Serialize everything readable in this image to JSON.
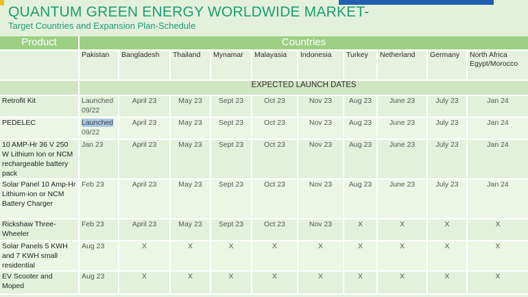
{
  "header": {
    "title": "QUANTUM GREEN ENERGY WORLDWIDE MARKET-",
    "subtitle": "Target Countries and Expansion Plan-Schedule"
  },
  "table": {
    "product_header": "Product",
    "countries_header": "Countries",
    "countries": [
      "Pakistan",
      "Bangladesh",
      "Thailand",
      "Mynamar",
      "Malayasia",
      "Indonesia",
      "Turkey",
      "Netherland",
      "Germany",
      "North Africa Egypt/Morocco"
    ],
    "band_label": "EXPECTED LAUNCH DATES",
    "rows": [
      {
        "product": "Retrofit Kit",
        "cells": [
          "Launched 09/22",
          "April 23",
          "May 23",
          "Sept 23",
          "Oct 23",
          "Nov 23",
          "Aug 23",
          "June 23",
          "July 23",
          "Jan 24"
        ]
      },
      {
        "product": "PEDELEC",
        "cells": [
          "Launched 09/22",
          "April 23",
          "May 23",
          "Sept 23",
          "Oct 23",
          "Nov 23",
          "Aug 23",
          "June 23",
          "July 23",
          "Jan 24"
        ]
      },
      {
        "product": "10 AMP-Hr 36 V 250 W Lithium Ion or NCM rechargeable battery pack",
        "cells": [
          "Jan 23",
          "April 23",
          "May 23",
          "Sept 23",
          "Oct 23",
          "Nov 23",
          "Aug 23",
          "June 23",
          "July 23",
          "Jan 24"
        ]
      },
      {
        "product": "Solar Panel 10 Amp-Hr Lithium-ion or NCM Battery Charger",
        "cells": [
          "Feb 23",
          "April 23",
          "May 23",
          "Sept 23",
          "Oct 23",
          "Nov 23",
          "Aug 23",
          "June 23",
          "July 23",
          "Jan 24"
        ]
      },
      {
        "product": "Rickshaw Three-Wheeler",
        "cells": [
          "Feb 23",
          "April 23",
          "May 23",
          "Sept 23",
          "Oct 23",
          "Nov 23",
          "X",
          "X",
          "X",
          "X"
        ]
      },
      {
        "product": "Solar Panels 5 KWH and 7 KWH small residential",
        "cells": [
          "Aug 23",
          "X",
          "X",
          "X",
          "X",
          "X",
          "X",
          "X",
          "X",
          "X"
        ]
      },
      {
        "product": "EV Scooter and Moped",
        "cells": [
          "Aug 23",
          "X",
          "X",
          "X",
          "X",
          "X",
          "X",
          "X",
          "X",
          "X"
        ]
      }
    ]
  },
  "colors": {
    "title": "#1b9c74",
    "header_band": "#9ccf83",
    "subheader_band": "#cfe6c2",
    "row_bg": "#e3f1da",
    "accent_blue": "#1f5fae",
    "accent_yellow": "#e8c21a"
  }
}
